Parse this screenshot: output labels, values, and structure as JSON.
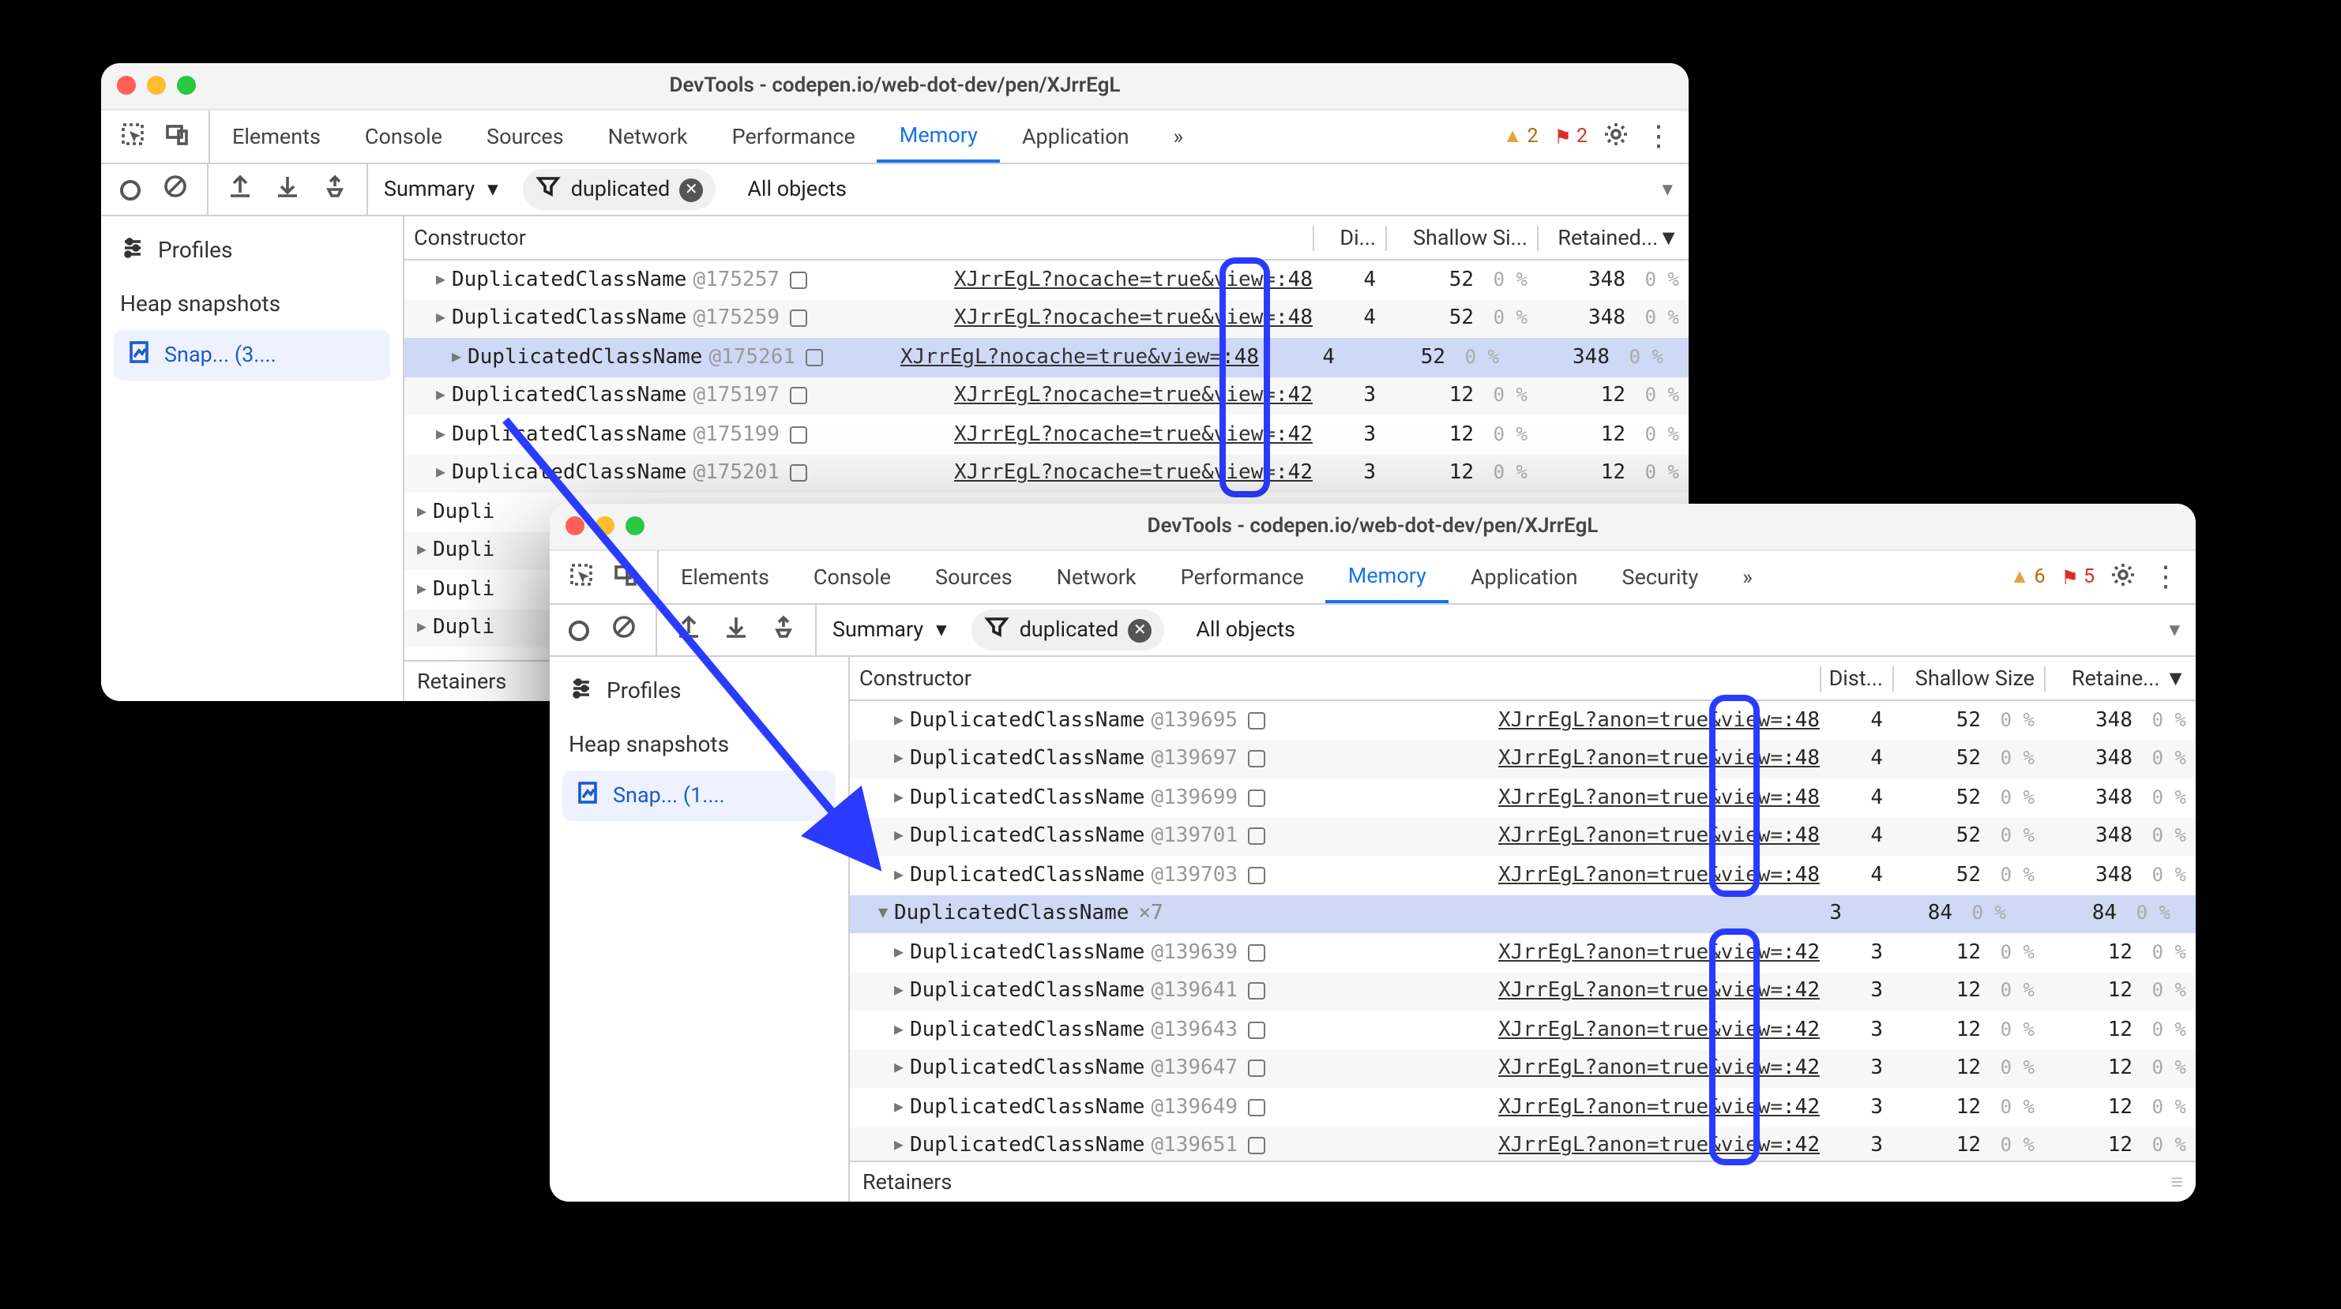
{
  "shared": {
    "title": "DevTools - codepen.io/web-dot-dev/pen/XJrrEgL",
    "tabs": [
      "Elements",
      "Console",
      "Sources",
      "Network",
      "Performance",
      "Memory",
      "Application",
      "Security"
    ],
    "active_tab": "Memory",
    "overflow": "»",
    "sidebar": {
      "profiles": "Profiles",
      "heap": "Heap snapshots"
    },
    "toolbar": {
      "summary": "Summary",
      "all_objects": "All objects",
      "filter": "duplicated"
    },
    "cols": {
      "constructor": "Constructor",
      "distance": "Di...",
      "distance2": "Dist...",
      "shallow": "Shallow Si...",
      "shallow2": "Shallow Size",
      "retained": "Retained...",
      "retained2": "Retaine...",
      "sort": "▼"
    },
    "retainers": "Retainers"
  },
  "win1": {
    "warn": "2",
    "err": "2",
    "snapshot": "Snap...  (3....",
    "link_prefix": "XJrrEgL?nocache=true&view=",
    "rows": [
      {
        "cls": "DuplicatedClassName",
        "id": "@175257",
        "tail": ":48",
        "dist": 4,
        "sh": 52,
        "rt": 348
      },
      {
        "cls": "DuplicatedClassName",
        "id": "@175259",
        "tail": ":48",
        "dist": 4,
        "sh": 52,
        "rt": 348
      },
      {
        "cls": "DuplicatedClassName",
        "id": "@175261",
        "tail": ":48",
        "dist": 4,
        "sh": 52,
        "rt": 348,
        "sel": true
      },
      {
        "cls": "DuplicatedClassName",
        "id": "@175197",
        "tail": ":42",
        "dist": 3,
        "sh": 12,
        "rt": 12
      },
      {
        "cls": "DuplicatedClassName",
        "id": "@175199",
        "tail": ":42",
        "dist": 3,
        "sh": 12,
        "rt": 12
      },
      {
        "cls": "DuplicatedClassName",
        "id": "@175201",
        "tail": ":42",
        "dist": 3,
        "sh": 12,
        "rt": 12
      }
    ],
    "stubs": [
      "Dupli",
      "Dupli",
      "Dupli",
      "Dupli"
    ]
  },
  "win2": {
    "warn": "6",
    "err": "5",
    "snapshot": "Snap...  (1....",
    "link_prefix": "XJrrEgL?anon=true&view=",
    "rows_top": [
      {
        "cls": "DuplicatedClassName",
        "id": "@139695",
        "tail": ":48",
        "dist": 4,
        "sh": 52,
        "rt": 348
      },
      {
        "cls": "DuplicatedClassName",
        "id": "@139697",
        "tail": ":48",
        "dist": 4,
        "sh": 52,
        "rt": 348
      },
      {
        "cls": "DuplicatedClassName",
        "id": "@139699",
        "tail": ":48",
        "dist": 4,
        "sh": 52,
        "rt": 348
      },
      {
        "cls": "DuplicatedClassName",
        "id": "@139701",
        "tail": ":48",
        "dist": 4,
        "sh": 52,
        "rt": 348
      },
      {
        "cls": "DuplicatedClassName",
        "id": "@139703",
        "tail": ":48",
        "dist": 4,
        "sh": 52,
        "rt": 348
      }
    ],
    "group": {
      "cls": "DuplicatedClassName",
      "mult": "×7",
      "dist": 3,
      "sh": 84,
      "rt": 84
    },
    "rows_bot": [
      {
        "cls": "DuplicatedClassName",
        "id": "@139639",
        "tail": ":42",
        "dist": 3,
        "sh": 12,
        "rt": 12
      },
      {
        "cls": "DuplicatedClassName",
        "id": "@139641",
        "tail": ":42",
        "dist": 3,
        "sh": 12,
        "rt": 12
      },
      {
        "cls": "DuplicatedClassName",
        "id": "@139643",
        "tail": ":42",
        "dist": 3,
        "sh": 12,
        "rt": 12
      },
      {
        "cls": "DuplicatedClassName",
        "id": "@139647",
        "tail": ":42",
        "dist": 3,
        "sh": 12,
        "rt": 12
      },
      {
        "cls": "DuplicatedClassName",
        "id": "@139649",
        "tail": ":42",
        "dist": 3,
        "sh": 12,
        "rt": 12
      },
      {
        "cls": "DuplicatedClassName",
        "id": "@139651",
        "tail": ":42",
        "dist": 3,
        "sh": 12,
        "rt": 12
      }
    ]
  },
  "pct": "0 %"
}
